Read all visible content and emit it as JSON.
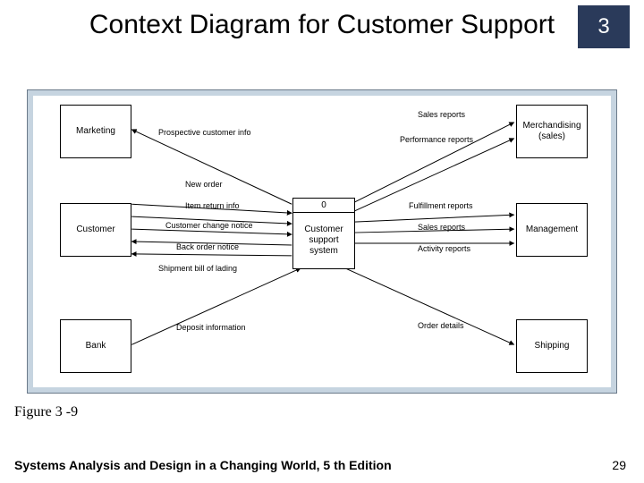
{
  "chapter": "3",
  "title": "Context Diagram for Customer Support",
  "figure_label": "Figure 3 -9",
  "footer": "Systems Analysis and Design in a Changing World, 5 th Edition",
  "page": "29",
  "process": {
    "id": "0",
    "name": "Customer support system"
  },
  "entities": {
    "marketing": "Marketing",
    "customer": "Customer",
    "bank": "Bank",
    "merch": "Merchandising (sales)",
    "management": "Management",
    "shipping": "Shipping"
  },
  "flows": {
    "prospective": "Prospective customer info",
    "new_order": "New order",
    "item_return": "Item return info",
    "change_notice": "Customer change notice",
    "back_order": "Back order notice",
    "ship_lading": "Shipment bill of lading",
    "deposit": "Deposit information",
    "sales_reports_top": "Sales reports",
    "performance": "Performance reports",
    "fulfillment": "Fulfillment reports",
    "sales_reports_mid": "Sales reports",
    "activity": "Activity reports",
    "order_details": "Order details"
  }
}
